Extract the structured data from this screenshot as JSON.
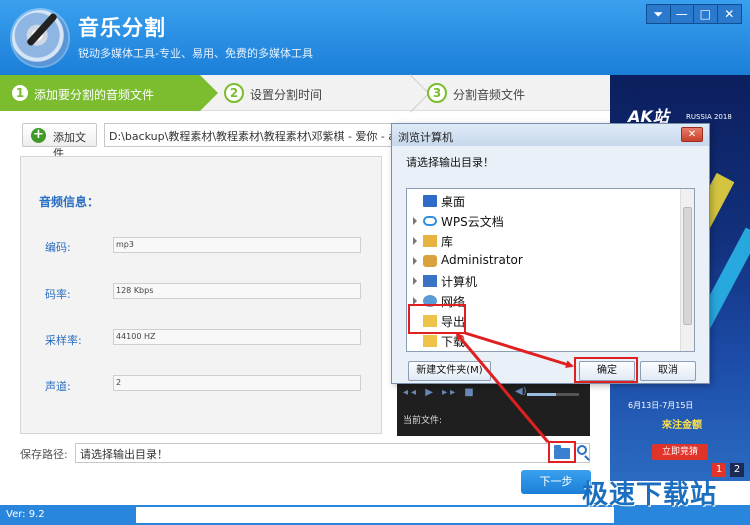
{
  "header": {
    "title": "音乐分割",
    "subtitle": "锐动多媒体工具-专业、易用、免费的多媒体工具",
    "controls": [
      "⏷",
      "—",
      "□",
      "✕"
    ]
  },
  "steps": [
    {
      "num": "1",
      "label": "添加要分割的音频文件"
    },
    {
      "num": "2",
      "label": "设置分割时间"
    },
    {
      "num": "3",
      "label": "分割音频文件"
    }
  ],
  "toolbar": {
    "add_file_label": "添加文件",
    "file_path": "D:\\backup\\教程素材\\教程素材\\教程素材\\邓紫棋 - 爱你 - ainy"
  },
  "info": {
    "title": "音频信息：",
    "fields": [
      {
        "label": "编码:",
        "value": "mp3"
      },
      {
        "label": "码率:",
        "value": "128 Kbps"
      },
      {
        "label": "采样率:",
        "value": "44100 HZ"
      },
      {
        "label": "声道:",
        "value": "2"
      }
    ]
  },
  "player": {
    "current_file_label": "当前文件:",
    "controls": "◂◂ ▶ ▸▸ ■",
    "volume_level": 0.55
  },
  "save": {
    "label": "保存路径:",
    "value": "请选择输出目录！"
  },
  "next_label": "下一步",
  "footer": {
    "version": "Ver: 9.2",
    "watermark": "极速下载站"
  },
  "ad": {
    "brand": "AK站",
    "tagline": "RUSSIA 2018",
    "date": "6月13日-7月15日",
    "text": "來注金额",
    "button": "立即竞猜",
    "pages": [
      "1",
      "2"
    ]
  },
  "dialog": {
    "title": "浏览计算机",
    "prompt": "请选择输出目录！",
    "tree": [
      {
        "label": "桌面",
        "icon": "desktop-icon"
      },
      {
        "label": "WPS云文档",
        "icon": "cloud-icon"
      },
      {
        "label": "库",
        "icon": "library-icon"
      },
      {
        "label": "Administrator",
        "icon": "user-folder-icon"
      },
      {
        "label": "计算机",
        "icon": "computer-icon"
      },
      {
        "label": "网络",
        "icon": "network-icon"
      },
      {
        "label": "导出",
        "icon": "folder-icon"
      },
      {
        "label": "下载",
        "icon": "folder-icon"
      }
    ],
    "new_folder_label": "新建文件夹(M)",
    "ok_label": "确定",
    "cancel_label": "取消"
  },
  "colors": {
    "accent": "#1b7fd8",
    "step_active": "#7bbd2e",
    "highlight": "#e02020"
  }
}
